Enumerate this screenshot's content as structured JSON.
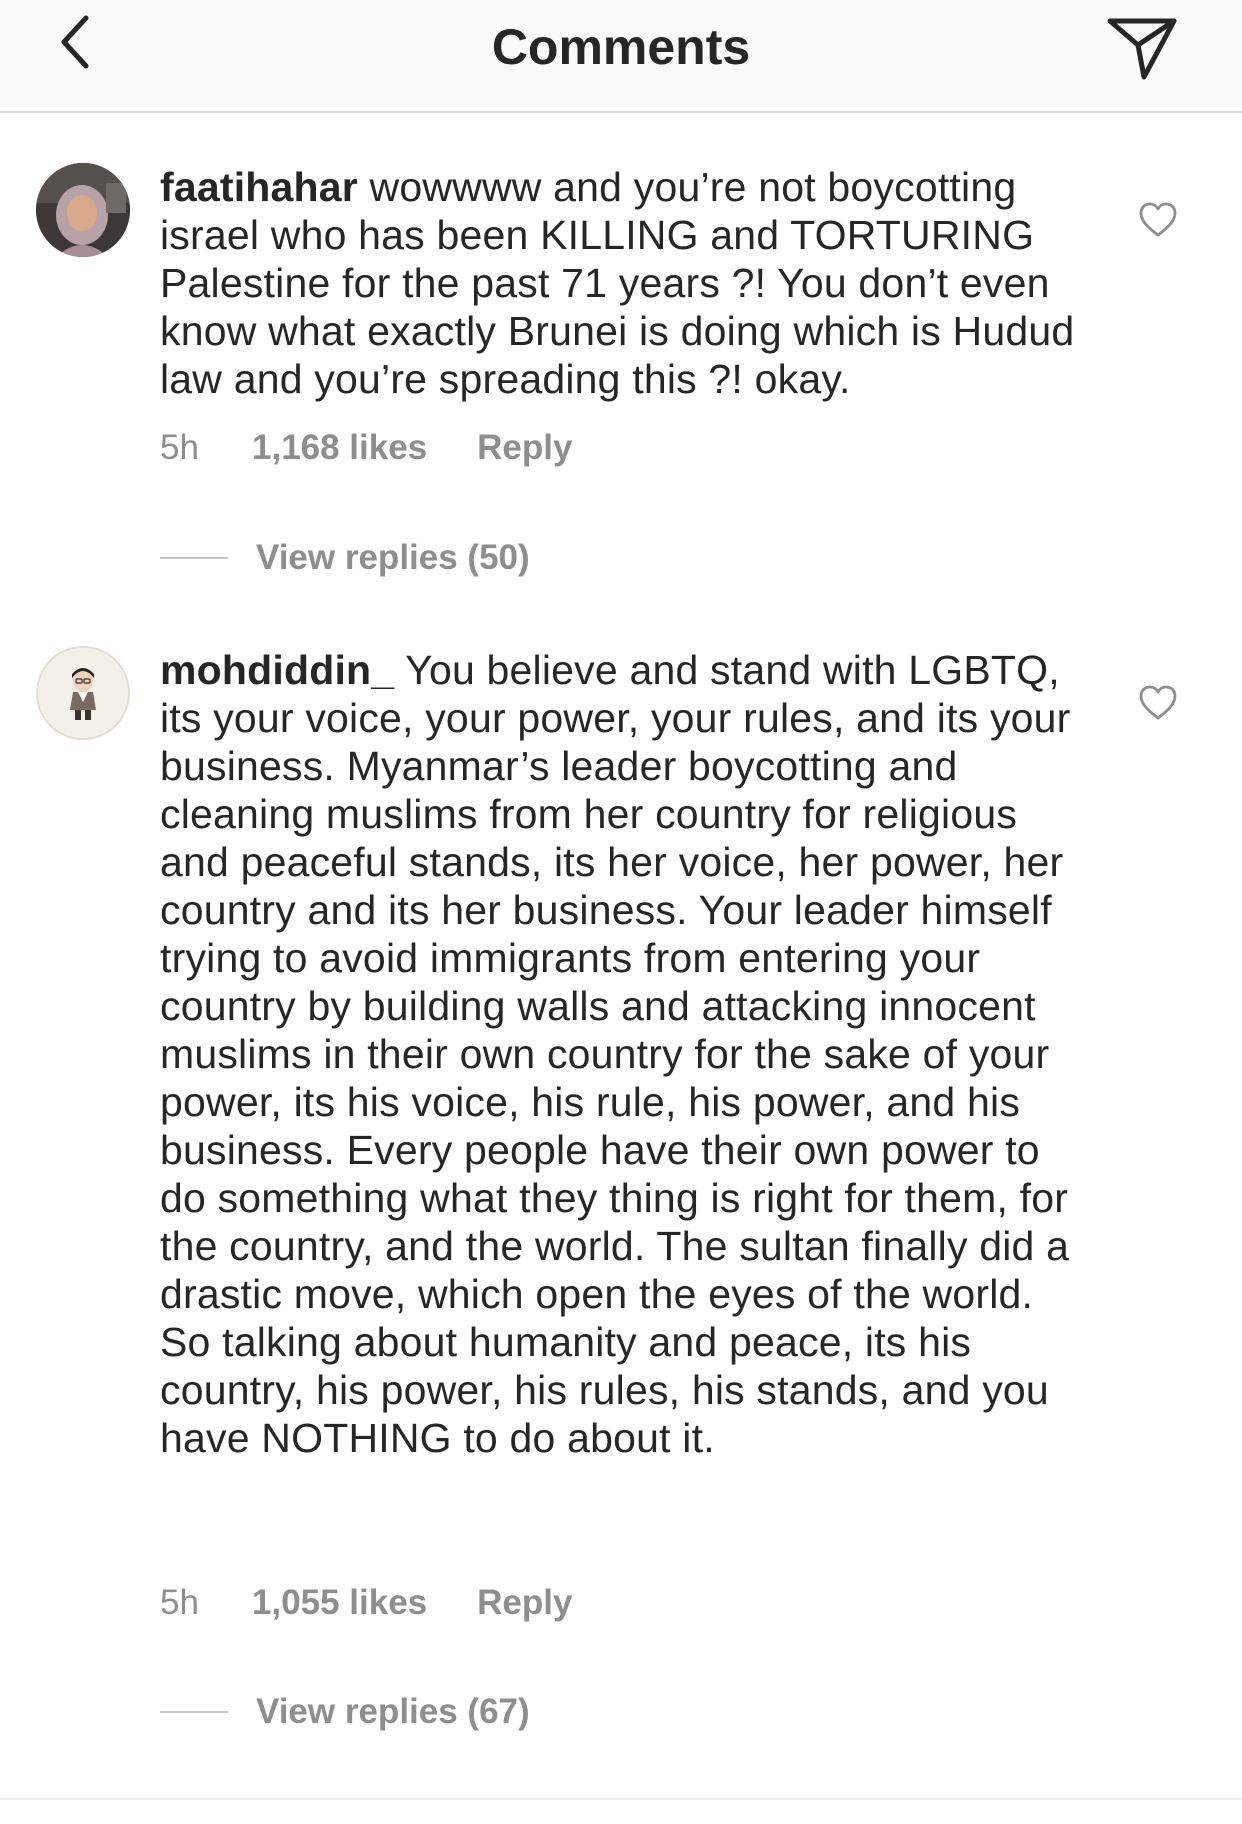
{
  "header": {
    "title": "Comments",
    "back_icon": "chevron-left-icon",
    "send_icon": "paper-plane-icon"
  },
  "comments": [
    {
      "username": "faatihahar",
      "text": " wowwww and you’re not boycotting israel who has been KILLING and TORTURING Palestine for the past 71 years ?! You don’t even know what exactly Brunei is doing which is Hudud law and you’re spreading this ?! okay.",
      "time": "5h",
      "likes": "1,168 likes",
      "reply_label": "Reply",
      "view_replies": "View replies (50)"
    },
    {
      "username": "mohdiddin_",
      "text": " You believe and stand with LGBTQ, its your voice, your power, your rules, and its your business. Myanmar’s leader boycotting and cleaning muslims from her country for religious and peaceful stands, its her voice, her power, her country and its her business. Your leader himself trying to avoid immigrants from entering your country by building walls and attacking innocent muslims in their own country for the sake of your power, its his voice, his rule, his power, and his business. Every people have their own power to do something what they thing is right for them, for the country, and the world. The sultan finally did a drastic move, which open the eyes of the world. So talking about humanity and peace, its his country, his power, his rules, his stands, and you have NOTHING to do about it.",
      "time": "5h",
      "likes": "1,055 likes",
      "reply_label": "Reply",
      "view_replies": "View replies (67)"
    }
  ],
  "colors": {
    "text": "#262626",
    "meta": "#8e8e8e",
    "header_bg": "#fafafa",
    "divider": "#dbdbdb"
  }
}
